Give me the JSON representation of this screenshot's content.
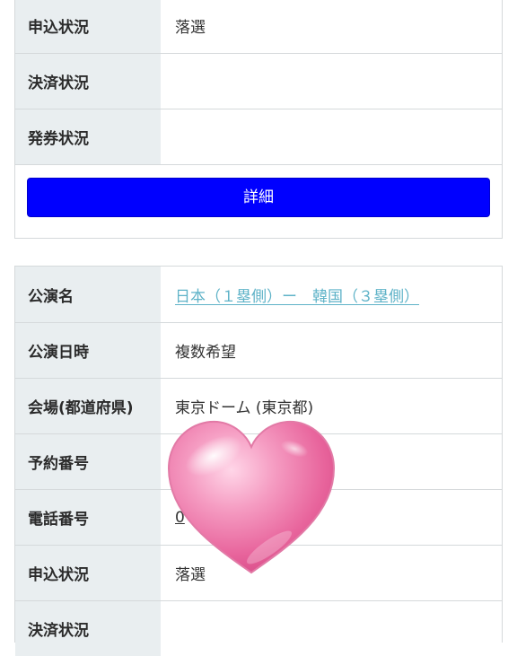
{
  "card1": {
    "rows": [
      {
        "label": "申込状況",
        "value": "落選"
      },
      {
        "label": "決済状況",
        "value": ""
      },
      {
        "label": "発券状況",
        "value": ""
      }
    ],
    "button_label": "詳細"
  },
  "card2": {
    "rows": [
      {
        "label": "公演名",
        "value": "日本（１塁側）ー　韓国（３塁側）"
      },
      {
        "label": "公演日時",
        "value": "複数希望"
      },
      {
        "label": "会場(都道府県)",
        "value": "東京ドーム (東京都)"
      },
      {
        "label": "予約番号",
        "value": ""
      },
      {
        "label": "電話番号",
        "value": "0"
      },
      {
        "label": "申込状況",
        "value": "落選"
      },
      {
        "label": "決済状況",
        "value": ""
      }
    ]
  },
  "colors": {
    "button": "#0000ff",
    "link": "#5fb3c8",
    "label_bg": "#e9eef0",
    "sticker": "#ef7fae"
  }
}
